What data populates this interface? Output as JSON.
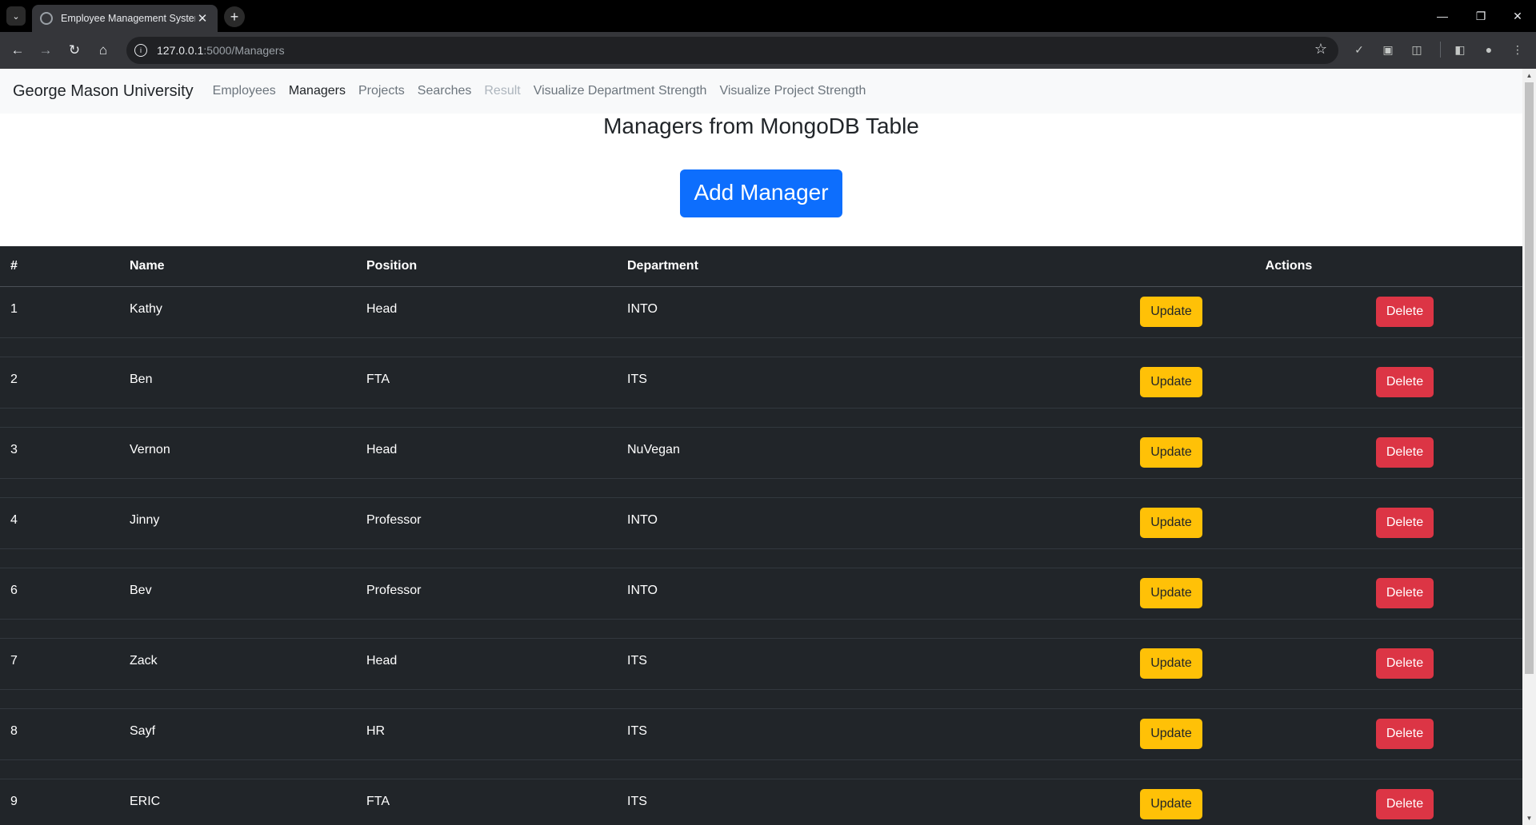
{
  "browser": {
    "tab_title": "Employee Management System",
    "url_host": "127.0.0.1",
    "url_path": ":5000/Managers"
  },
  "navbar": {
    "brand": "George Mason University",
    "links": [
      {
        "label": "Employees"
      },
      {
        "label": "Managers"
      },
      {
        "label": "Projects"
      },
      {
        "label": "Searches"
      },
      {
        "label": "Result"
      },
      {
        "label": "Visualize Department Strength"
      },
      {
        "label": "Visualize Project Strength"
      }
    ]
  },
  "main": {
    "title": "Managers from MongoDB Table",
    "add_button": "Add Manager"
  },
  "table": {
    "headers": [
      "#",
      "Name",
      "Position",
      "Department",
      "Actions"
    ],
    "update_label": "Update",
    "delete_label": "Delete",
    "rows": [
      {
        "id": "1",
        "name": "Kathy",
        "position": "Head",
        "department": "INTO"
      },
      {
        "id": "2",
        "name": "Ben",
        "position": "FTA",
        "department": "ITS"
      },
      {
        "id": "3",
        "name": "Vernon",
        "position": "Head",
        "department": "NuVegan"
      },
      {
        "id": "4",
        "name": "Jinny",
        "position": "Professor",
        "department": "INTO"
      },
      {
        "id": "6",
        "name": "Bev",
        "position": "Professor",
        "department": "INTO"
      },
      {
        "id": "7",
        "name": "Zack",
        "position": "Head",
        "department": "ITS"
      },
      {
        "id": "8",
        "name": "Sayf",
        "position": "HR",
        "department": "ITS"
      },
      {
        "id": "9",
        "name": "ERIC",
        "position": "FTA",
        "department": "ITS"
      }
    ]
  },
  "colors": {
    "primary": "#0d6efd",
    "warning": "#ffc107",
    "danger": "#dc3545",
    "table_dark": "#212529"
  }
}
